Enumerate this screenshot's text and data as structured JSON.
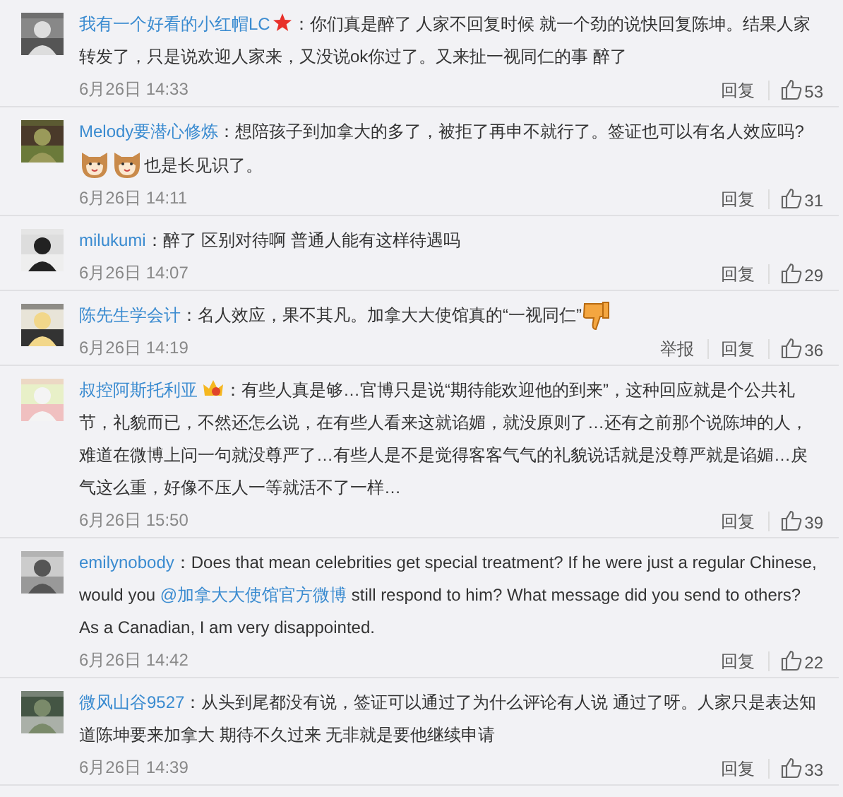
{
  "comments": [
    {
      "avatar": {
        "kind": "picture"
      },
      "user": "我有一个好看的小红帽LC",
      "segments": [
        {
          "kind": "star-icon"
        },
        {
          "kind": "text",
          "text": "：你们真是醉了 人家不回复时候 就一个劲的说快回复陈坤。结果人家转发了，只是说欢迎人家来，又没说ok你过了。又来扯一视同仁的事 醉了"
        }
      ],
      "time": "6月26日 14:33",
      "actions": [
        "回复"
      ],
      "likes": "53"
    },
    {
      "avatar": {
        "kind": "picture"
      },
      "user": "Melody要潜心修炼",
      "segments": [
        {
          "kind": "text",
          "text": "：想陪孩子到加拿大的多了，被拒了再申不就行了。签证也可以有名人效应吗?"
        },
        {
          "kind": "break"
        },
        {
          "kind": "dog-emoticon"
        },
        {
          "kind": "dog-emoticon"
        },
        {
          "kind": "text",
          "text": "也是长见识了。"
        }
      ],
      "time": "6月26日 14:11",
      "actions": [
        "回复"
      ],
      "likes": "31"
    },
    {
      "avatar": {
        "kind": "picture"
      },
      "user": "milukumi",
      "segments": [
        {
          "kind": "text",
          "text": "：醉了 区别对待啊 普通人能有这样待遇吗"
        }
      ],
      "time": "6月26日 14:07",
      "actions": [
        "回复"
      ],
      "likes": "29"
    },
    {
      "avatar": {
        "kind": "picture"
      },
      "user": "陈先生学会计",
      "segments": [
        {
          "kind": "text",
          "text": "：名人效应，果不其凡。加拿大大使馆真的“一视同仁”"
        },
        {
          "kind": "thumbs-down-emoticon"
        }
      ],
      "time": "6月26日 14:19",
      "actions": [
        "举报",
        "回复"
      ],
      "likes": "36"
    },
    {
      "avatar": {
        "kind": "picture"
      },
      "user": "叔控阿斯托利亚",
      "segments": [
        {
          "kind": "crown-icon"
        },
        {
          "kind": "text",
          "text": "：有些人真是够…官博只是说“期待能欢迎他的到来”，这种回应就是个公共礼节，礼貌而已，不然还怎么说，在有些人看来这就谄媚，就没原则了…还有之前那个说陈坤的人，难道在微博上问一句就没尊严了…有些人是不是觉得客客气气的礼貌说话就是没尊严就是谄媚…戾气这么重，好像不压人一等就活不了一样…"
        }
      ],
      "time": "6月26日 15:50",
      "actions": [
        "回复"
      ],
      "likes": "39"
    },
    {
      "avatar": {
        "kind": "picture"
      },
      "user": "emilynobody",
      "segments": [
        {
          "kind": "text",
          "text": "：Does that mean celebrities get special treatment? If he were just a regular Chinese, would you "
        },
        {
          "kind": "mention",
          "text": "@加拿大大使馆官方微博"
        },
        {
          "kind": "text",
          "text": " still respond to him? What message did you send to others? As a Canadian, I am very disappointed."
        }
      ],
      "time": "6月26日 14:42",
      "actions": [
        "回复"
      ],
      "likes": "22"
    },
    {
      "avatar": {
        "kind": "picture"
      },
      "user": "微风山谷9527",
      "segments": [
        {
          "kind": "text",
          "text": "：从头到尾都没有说，签证可以通过了为什么评论有人说 通过了呀。人家只是表达知道陈坤要来加拿大 期待不久过来 无非就是要他继续申请"
        }
      ],
      "time": "6月26日 14:39",
      "actions": [
        "回复"
      ],
      "likes": "33"
    }
  ]
}
